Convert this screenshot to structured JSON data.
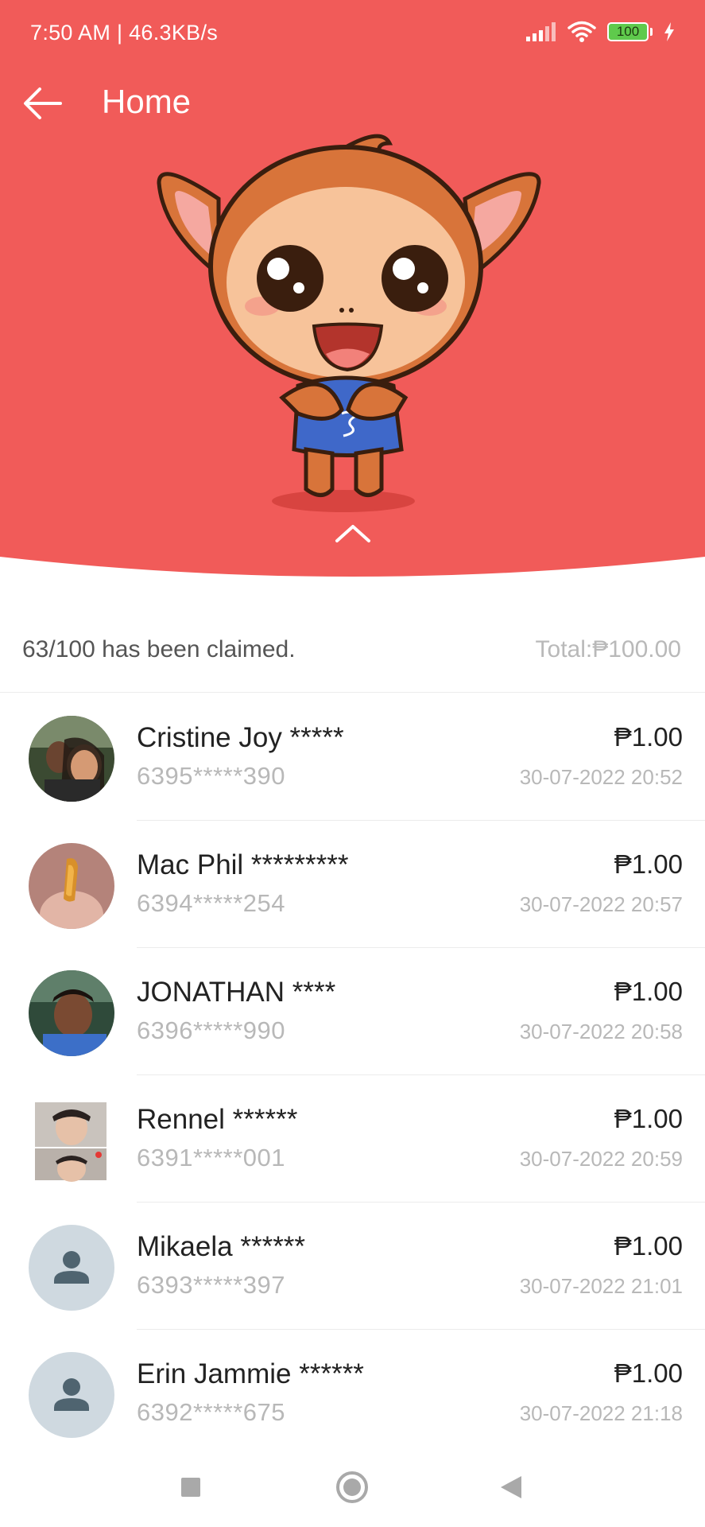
{
  "status_bar": {
    "time_speed": "7:50 AM | 46.3KB/s",
    "battery": "100"
  },
  "appbar": {
    "title": "Home"
  },
  "summary": {
    "claimed": "63/100 has been claimed.",
    "total": "Total:₱100.00"
  },
  "claims": [
    {
      "name": "Cristine Joy *****",
      "phone": "6395*****390",
      "amount": "₱1.00",
      "time": "30-07-2022 20:52",
      "avatar": "photo"
    },
    {
      "name": "Mac Phil *********",
      "phone": "6394*****254",
      "amount": "₱1.00",
      "time": "30-07-2022 20:57",
      "avatar": "photo"
    },
    {
      "name": "JONATHAN ****",
      "phone": "6396*****990",
      "amount": "₱1.00",
      "time": "30-07-2022 20:58",
      "avatar": "photo"
    },
    {
      "name": "Rennel ******",
      "phone": "6391*****001",
      "amount": "₱1.00",
      "time": "30-07-2022 20:59",
      "avatar": "photo"
    },
    {
      "name": "Mikaela ******",
      "phone": "6393*****397",
      "amount": "₱1.00",
      "time": "30-07-2022 21:01",
      "avatar": "default"
    },
    {
      "name": "Erin Jammie ******",
      "phone": "6392*****675",
      "amount": "₱1.00",
      "time": "30-07-2022 21:18",
      "avatar": "default"
    }
  ],
  "colors": {
    "hero": "#f15b59",
    "text_primary": "#222222",
    "text_secondary": "#b8b8b8"
  },
  "icons": [
    "back-arrow-icon",
    "chevron-up-icon",
    "signal-icon",
    "wifi-icon",
    "battery-icon",
    "charging-icon",
    "square-nav-icon",
    "home-nav-icon",
    "back-nav-icon"
  ]
}
